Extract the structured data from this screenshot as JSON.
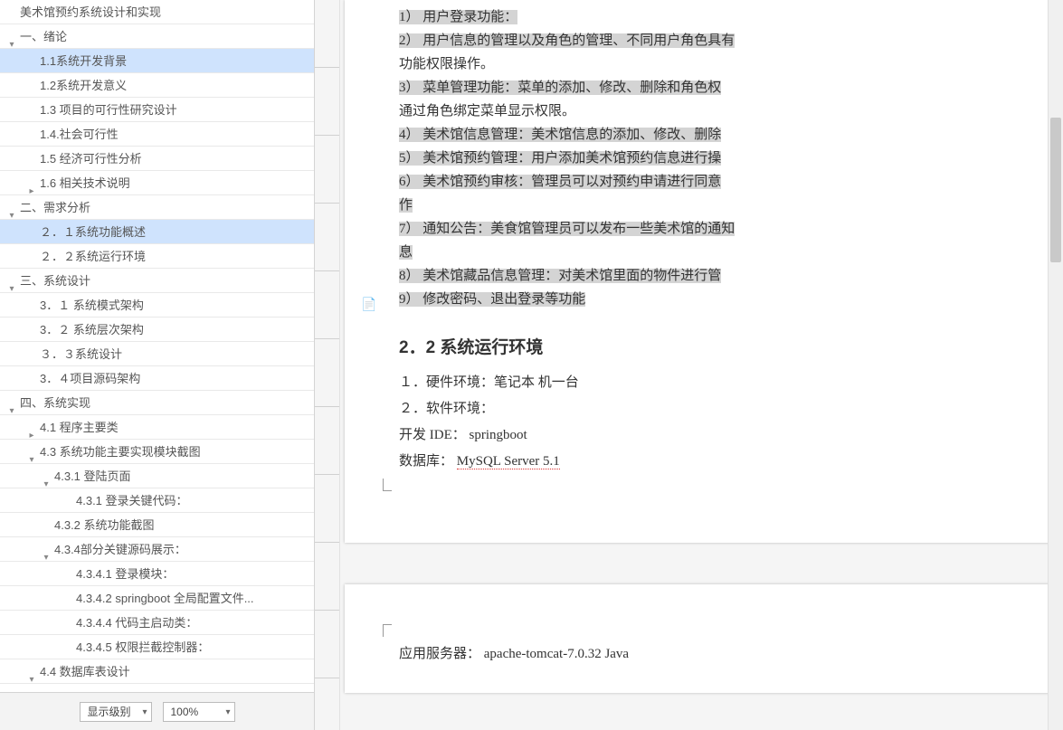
{
  "sidebar": {
    "items": [
      {
        "label": "美术馆预约系统设计和实现",
        "level": 0,
        "twist": "",
        "selected": false
      },
      {
        "label": "一、绪论",
        "level": 1,
        "twist": "▾",
        "selected": false
      },
      {
        "label": "1.1系统开发背景",
        "level": 2,
        "twist": "",
        "selected": true
      },
      {
        "label": "1.2系统开发意义",
        "level": 2,
        "twist": "",
        "selected": false
      },
      {
        "label": "1.3 项目的可行性研究设计",
        "level": 2,
        "twist": "",
        "selected": false
      },
      {
        "label": "1.4.社会可行性",
        "level": 2,
        "twist": "",
        "selected": false
      },
      {
        "label": "1.5 经济可行性分析",
        "level": 2,
        "twist": "",
        "selected": false
      },
      {
        "label": "1.6 相关技术说明",
        "level": 2,
        "twist": "▸",
        "selected": false
      },
      {
        "label": "二、需求分析",
        "level": 1,
        "twist": "▾",
        "selected": false
      },
      {
        "label": "２．１系统功能概述",
        "level": 2,
        "twist": "",
        "selected": true
      },
      {
        "label": "２．２系统运行环境",
        "level": 2,
        "twist": "",
        "selected": false
      },
      {
        "label": "三、系统设计",
        "level": 1,
        "twist": "▾",
        "selected": false
      },
      {
        "label": "3．１ 系统模式架构",
        "level": 2,
        "twist": "",
        "selected": false
      },
      {
        "label": "3．２ 系统层次架构",
        "level": 2,
        "twist": "",
        "selected": false
      },
      {
        "label": "３．３系统设计",
        "level": 2,
        "twist": "",
        "selected": false
      },
      {
        "label": "3．４项目源码架构",
        "level": 2,
        "twist": "",
        "selected": false
      },
      {
        "label": "四、系统实现",
        "level": 1,
        "twist": "▾",
        "selected": false
      },
      {
        "label": "4.1  程序主要类",
        "level": 2,
        "twist": "▸",
        "selected": false
      },
      {
        "label": "4.3 系统功能主要实现模块截图",
        "level": 2,
        "twist": "▾",
        "selected": false
      },
      {
        "label": "4.3.1 登陆页面",
        "level": 3,
        "twist": "▾",
        "selected": false
      },
      {
        "label": "4.3.1 登录关键代码：",
        "level": 4,
        "twist": "",
        "selected": false
      },
      {
        "label": "4.3.2 系统功能截图",
        "level": 3,
        "twist": "",
        "selected": false
      },
      {
        "label": "4.3.4部分关键源码展示：",
        "level": 3,
        "twist": "▾",
        "selected": false
      },
      {
        "label": "4.3.4.1 登录模块：",
        "level": 4,
        "twist": "",
        "selected": false
      },
      {
        "label": "4.3.4.2 springboot 全局配置文件...",
        "level": 4,
        "twist": "",
        "selected": false
      },
      {
        "label": "4.3.4.4 代码主启动类：",
        "level": 4,
        "twist": "",
        "selected": false
      },
      {
        "label": "4.3.4.5 权限拦截控制器：",
        "level": 4,
        "twist": "",
        "selected": false
      },
      {
        "label": "4.4 数据库表设计",
        "level": 2,
        "twist": "▾",
        "selected": false
      }
    ]
  },
  "bottom": {
    "level_label": "显示级别",
    "zoom_label": "100%"
  },
  "doc": {
    "lines": [
      "1） 用户登录功能：",
      "2） 用户信息的管理以及角色的管理、不同用户角色具有",
      "功能权限操作。",
      "3） 菜单管理功能：菜单的添加、修改、删除和角色权",
      "通过角色绑定菜单显示权限。",
      "4） 美术馆信息管理：美术馆信息的添加、修改、删除",
      "5） 美术馆预约管理：用户添加美术馆预约信息进行操",
      "6） 美术馆预约审核：管理员可以对预约申请进行同意",
      "作",
      "7） 通知公告：美食馆管理员可以发布一些美术馆的通知",
      "息",
      "8） 美术馆藏品信息管理：对美术馆里面的物件进行管",
      "9） 修改密码、退出登录等功能"
    ],
    "highlight_off": [
      2,
      4
    ],
    "section_2_2": "2．2 系统运行环境",
    "env": {
      "hw": "１．硬件环境：笔记本  机一台",
      "sw": "２．软件环境：",
      "ide": "开发  IDE： springboot",
      "db_prefix": "数据库：    ",
      "db_value": "MySQL Server 5.1"
    },
    "page2_line": "应用服务器：   apache-tomcat-7.0.32 Java"
  }
}
